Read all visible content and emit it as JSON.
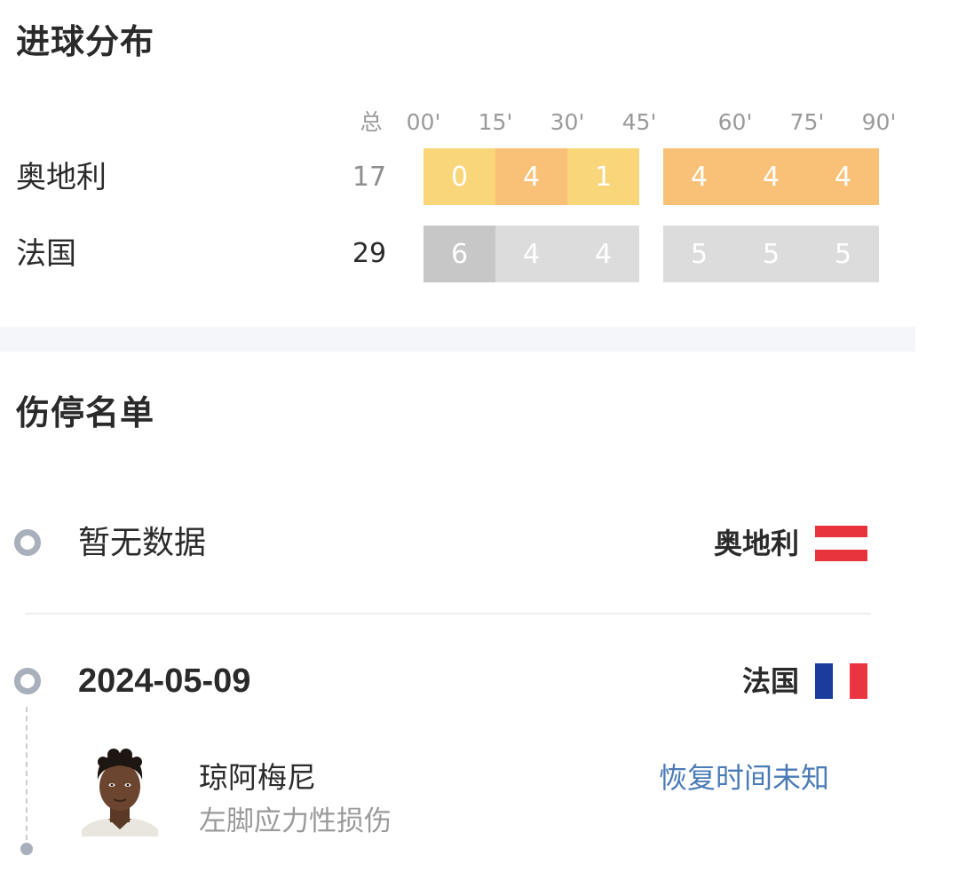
{
  "goals": {
    "title": "进球分布",
    "headers": {
      "total": "总",
      "ticks": [
        "00'",
        "15'",
        "30'",
        "45'",
        "60'",
        "75'",
        "90'"
      ]
    },
    "teams": [
      {
        "name": "奥地利",
        "total": "17",
        "first_half": [
          "0",
          "4",
          "1"
        ],
        "second_half": [
          "4",
          "4",
          "4"
        ]
      },
      {
        "name": "法国",
        "total": "29",
        "first_half": [
          "6",
          "4",
          "4"
        ],
        "second_half": [
          "5",
          "5",
          "5"
        ]
      }
    ],
    "colors": {
      "austria_light": "#fad67a",
      "austria_dark": "#f9c077",
      "france_light": "#dcdcdc",
      "france_dark": "#c7c7c7"
    }
  },
  "injuries": {
    "title": "伤停名单",
    "entries": [
      {
        "left_text": "暂无数据",
        "team": "奥地利"
      },
      {
        "left_text": "2024-05-09",
        "team": "法国",
        "player": {
          "name": "琼阿梅尼",
          "injury": "左脚应力性损伤",
          "status": "恢复时间未知"
        }
      }
    ]
  }
}
